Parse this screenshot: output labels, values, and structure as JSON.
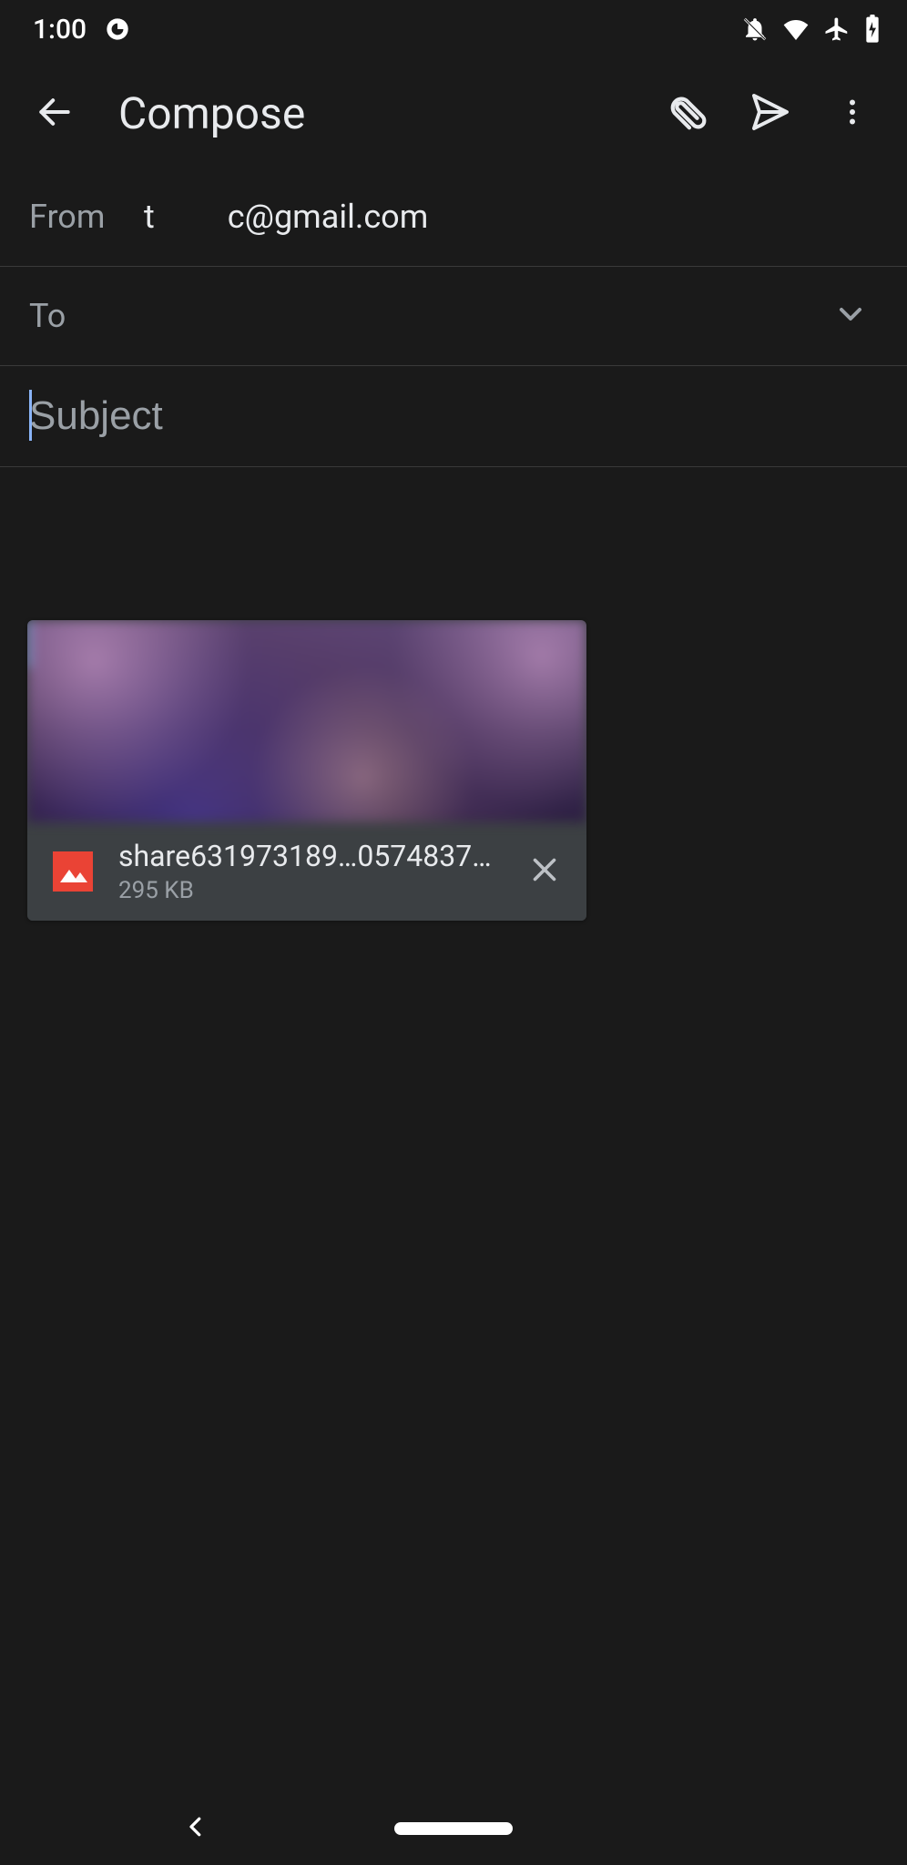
{
  "status": {
    "time": "1:00"
  },
  "header": {
    "title": "Compose"
  },
  "from": {
    "label": "From",
    "part1": "t",
    "part2": "c@gmail.com"
  },
  "to": {
    "label": "To",
    "value": ""
  },
  "subject": {
    "placeholder": "Subject",
    "value": ""
  },
  "body": {
    "placeholder": "",
    "value": ""
  },
  "attachment": {
    "filename": "share631973189…05748371.png",
    "size": "295 KB"
  }
}
